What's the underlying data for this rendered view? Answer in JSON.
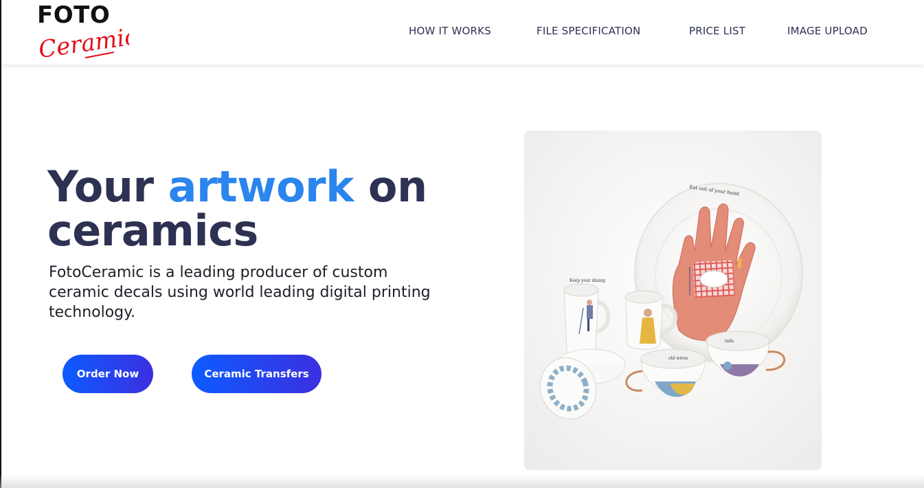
{
  "brand": {
    "logo_top": "FOTO",
    "logo_script": "Ceramic"
  },
  "nav": {
    "items": [
      {
        "label": "HOW IT WORKS"
      },
      {
        "label": "FILE SPECIFICATION"
      },
      {
        "label": "PRICE LIST"
      },
      {
        "label": "IMAGE UPLOAD"
      }
    ]
  },
  "hero": {
    "title_part1": "Your ",
    "title_accent": "artwork",
    "title_part2": " on ceramics",
    "description": "FotoCeramic is a leading producer of custom ceramic decals using world leading digital printing technology.",
    "order_button": "Order Now",
    "transfers_button": "Ceramic Transfers",
    "image_captions": [
      "Eat out of your hand",
      "Keep your dining",
      "old wives",
      "tails"
    ]
  },
  "colors": {
    "heading": "#2d3152",
    "accent": "#2b85ee",
    "button_gradient_start": "#0d5cff",
    "button_gradient_end": "#3b2fe0",
    "logo_script": "#e0101a"
  }
}
